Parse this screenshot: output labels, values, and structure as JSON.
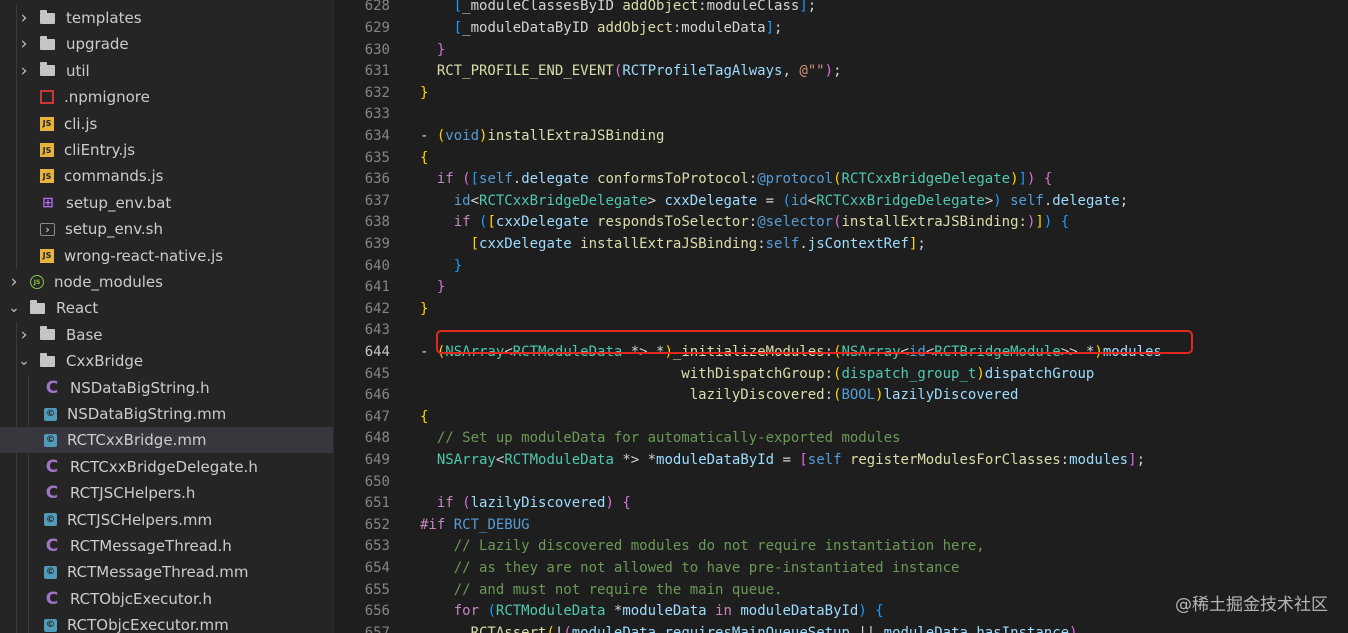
{
  "sidebar": {
    "items": [
      {
        "label": "templates",
        "kind": "folder",
        "state": "collapsed",
        "depth": 1
      },
      {
        "label": "upgrade",
        "kind": "folder",
        "state": "collapsed",
        "depth": 1
      },
      {
        "label": "util",
        "kind": "folder",
        "state": "collapsed",
        "depth": 1
      },
      {
        "label": ".npmignore",
        "kind": "npm",
        "depth": 1
      },
      {
        "label": "cli.js",
        "kind": "js",
        "depth": 1
      },
      {
        "label": "cliEntry.js",
        "kind": "js",
        "depth": 1
      },
      {
        "label": "commands.js",
        "kind": "js",
        "depth": 1
      },
      {
        "label": "setup_env.bat",
        "kind": "bat",
        "depth": 1
      },
      {
        "label": "setup_env.sh",
        "kind": "sh",
        "depth": 1
      },
      {
        "label": "wrong-react-native.js",
        "kind": "js",
        "depth": 1
      },
      {
        "label": "node_modules",
        "kind": "node",
        "state": "collapsed",
        "depth": 0
      },
      {
        "label": "React",
        "kind": "folder",
        "state": "expanded",
        "depth": 0
      },
      {
        "label": "Base",
        "kind": "folder",
        "state": "collapsed",
        "depth": 1
      },
      {
        "label": "CxxBridge",
        "kind": "folder",
        "state": "expanded",
        "depth": 1
      },
      {
        "label": "NSDataBigString.h",
        "kind": "c",
        "depth": 2
      },
      {
        "label": "NSDataBigString.mm",
        "kind": "mm",
        "depth": 2
      },
      {
        "label": "RCTCxxBridge.mm",
        "kind": "mm",
        "depth": 2,
        "selected": true
      },
      {
        "label": "RCTCxxBridgeDelegate.h",
        "kind": "c",
        "depth": 2
      },
      {
        "label": "RCTJSCHelpers.h",
        "kind": "c",
        "depth": 2
      },
      {
        "label": "RCTJSCHelpers.mm",
        "kind": "mm",
        "depth": 2
      },
      {
        "label": "RCTMessageThread.h",
        "kind": "c",
        "depth": 2
      },
      {
        "label": "RCTMessageThread.mm",
        "kind": "mm",
        "depth": 2
      },
      {
        "label": "RCTObjcExecutor.h",
        "kind": "c",
        "depth": 2
      },
      {
        "label": "RCTObjcExecutor.mm",
        "kind": "mm",
        "depth": 2
      }
    ]
  },
  "editor": {
    "active_line": "644",
    "lines": [
      {
        "n": "628",
        "html": "    <span class=\"br3\">[</span>_moduleClassesByID <span class=\"fn\">addObject</span>:moduleClass<span class=\"br3\">]</span>;"
      },
      {
        "n": "629",
        "html": "    <span class=\"br3\">[</span>_moduleDataByID <span class=\"fn\">addObject</span>:moduleData<span class=\"br3\">]</span>;"
      },
      {
        "n": "630",
        "html": "  <span class=\"br2\">}</span>"
      },
      {
        "n": "631",
        "html": "  <span class=\"fn\">RCT_PROFILE_END_EVENT</span><span class=\"br2\">(</span><span class=\"vr\">RCTProfileTagAlways</span>, <span class=\"st\">@\"\"</span><span class=\"br2\">)</span>;"
      },
      {
        "n": "632",
        "html": "<span class=\"br1\">}</span>"
      },
      {
        "n": "633",
        "html": ""
      },
      {
        "n": "634",
        "html": "- <span class=\"br1\">(</span><span class=\"kw\">void</span><span class=\"br1\">)</span><span class=\"fn\">installExtraJSBinding</span>"
      },
      {
        "n": "635",
        "html": "<span class=\"br1\">{</span>"
      },
      {
        "n": "636",
        "html": "  <span class=\"ct\">if</span> <span class=\"br2\">(</span><span class=\"br3\">[</span><span class=\"kw\">self</span>.<span class=\"vr\">delegate</span> <span class=\"fn\">conformsToProtocol</span>:<span class=\"kw\">@protocol</span><span class=\"br1\">(</span><span class=\"ty\">RCTCxxBridgeDelegate</span><span class=\"br1\">)</span><span class=\"br3\">]</span><span class=\"br2\">)</span> <span class=\"br2\">{</span>"
      },
      {
        "n": "637",
        "html": "    <span class=\"kw\">id</span>&lt;<span class=\"ty\">RCTCxxBridgeDelegate</span>&gt; <span class=\"vr\">cxxDelegate</span> = <span class=\"br3\">(</span><span class=\"kw\">id</span>&lt;<span class=\"ty\">RCTCxxBridgeDelegate</span>&gt;<span class=\"br3\">)</span> <span class=\"kw\">self</span>.<span class=\"vr\">delegate</span>;"
      },
      {
        "n": "638",
        "html": "    <span class=\"ct\">if</span> <span class=\"br3\">(</span><span class=\"br1\">[</span><span class=\"vr\">cxxDelegate</span> <span class=\"fn\">respondsToSelector</span>:<span class=\"kw\">@selector</span><span class=\"br2\">(</span><span class=\"fn\">installExtraJSBinding:</span><span class=\"br2\">)</span><span class=\"br1\">]</span><span class=\"br3\">)</span> <span class=\"br3\">{</span>"
      },
      {
        "n": "639",
        "html": "      <span class=\"br1\">[</span><span class=\"vr\">cxxDelegate</span> <span class=\"fn\">installExtraJSBinding</span>:<span class=\"kw\">self</span>.<span class=\"vr\">jsContextRef</span><span class=\"br1\">]</span>;"
      },
      {
        "n": "640",
        "html": "    <span class=\"br3\">}</span>"
      },
      {
        "n": "641",
        "html": "  <span class=\"br2\">}</span>"
      },
      {
        "n": "642",
        "html": "<span class=\"br1\">}</span>"
      },
      {
        "n": "643",
        "html": ""
      },
      {
        "n": "644",
        "html": "- <span class=\"br1\">(</span><span class=\"ty\">NSArray</span>&lt;<span class=\"ty\">RCTModuleData</span> *&gt; *<span class=\"br1\">)</span><span class=\"fn\">_initializeModules</span>:<span class=\"br1\">(</span><span class=\"ty\">NSArray</span>&lt;<span class=\"kw\">id</span>&lt;<span class=\"ty\">RCTBridgeModule</span>&gt;&gt; *<span class=\"br1\">)</span><span class=\"vr\">modules</span>"
      },
      {
        "n": "645",
        "html": "                               <span class=\"fn\">withDispatchGroup</span>:<span class=\"br1\">(</span><span class=\"ty\">dispatch_group_t</span><span class=\"br1\">)</span><span class=\"vr\">dispatchGroup</span>"
      },
      {
        "n": "646",
        "html": "                                <span class=\"fn\">lazilyDiscovered</span>:<span class=\"br1\">(</span><span class=\"kw\">BOOL</span><span class=\"br1\">)</span><span class=\"vr\">lazilyDiscovered</span>"
      },
      {
        "n": "647",
        "html": "<span class=\"br1\">{</span>"
      },
      {
        "n": "648",
        "html": "  <span class=\"cm\">// Set up moduleData for automatically-exported modules</span>"
      },
      {
        "n": "649",
        "html": "  <span class=\"ty\">NSArray</span>&lt;<span class=\"ty\">RCTModuleData</span> *&gt; *<span class=\"vr\">moduleDataById</span> = <span class=\"br2\">[</span><span class=\"kw\">self</span> <span class=\"fn\">registerModulesForClasses</span>:<span class=\"vr\">modules</span><span class=\"br2\">]</span>;"
      },
      {
        "n": "650",
        "html": ""
      },
      {
        "n": "651",
        "html": "  <span class=\"ct\">if</span> <span class=\"br2\">(</span><span class=\"vr\">lazilyDiscovered</span><span class=\"br2\">)</span> <span class=\"br2\">{</span>"
      },
      {
        "n": "652",
        "html": "<span class=\"pp\">#if</span> <span class=\"kw\">RCT_DEBUG</span>"
      },
      {
        "n": "653",
        "html": "    <span class=\"cm\">// Lazily discovered modules do not require instantiation here,</span>"
      },
      {
        "n": "654",
        "html": "    <span class=\"cm\">// as they are not allowed to have pre-instantiated instance</span>"
      },
      {
        "n": "655",
        "html": "    <span class=\"cm\">// and must not require the main queue.</span>"
      },
      {
        "n": "656",
        "html": "    <span class=\"ct\">for</span> <span class=\"br3\">(</span><span class=\"ty\">RCTModuleData</span> *<span class=\"vr\">moduleData</span> <span class=\"ct\">in</span> <span class=\"vr\">moduleDataById</span><span class=\"br3\">)</span> <span class=\"br3\">{</span>"
      },
      {
        "n": "657",
        "html": "      <span class=\"fn\">RCTAssert</span><span class=\"br1\">(</span>!<span class=\"br2\">(</span><span class=\"vr\">moduleData</span>.<span class=\"vr\">requiresMainQueueSetup</span> || <span class=\"vr\">moduleData</span>.<span class=\"vr\">hasInstance</span><span class=\"br2\">)</span>,"
      }
    ],
    "fold_markers": {
      "634": "-",
      "644": "-"
    }
  },
  "watermark": "@稀土掘金技术社区"
}
